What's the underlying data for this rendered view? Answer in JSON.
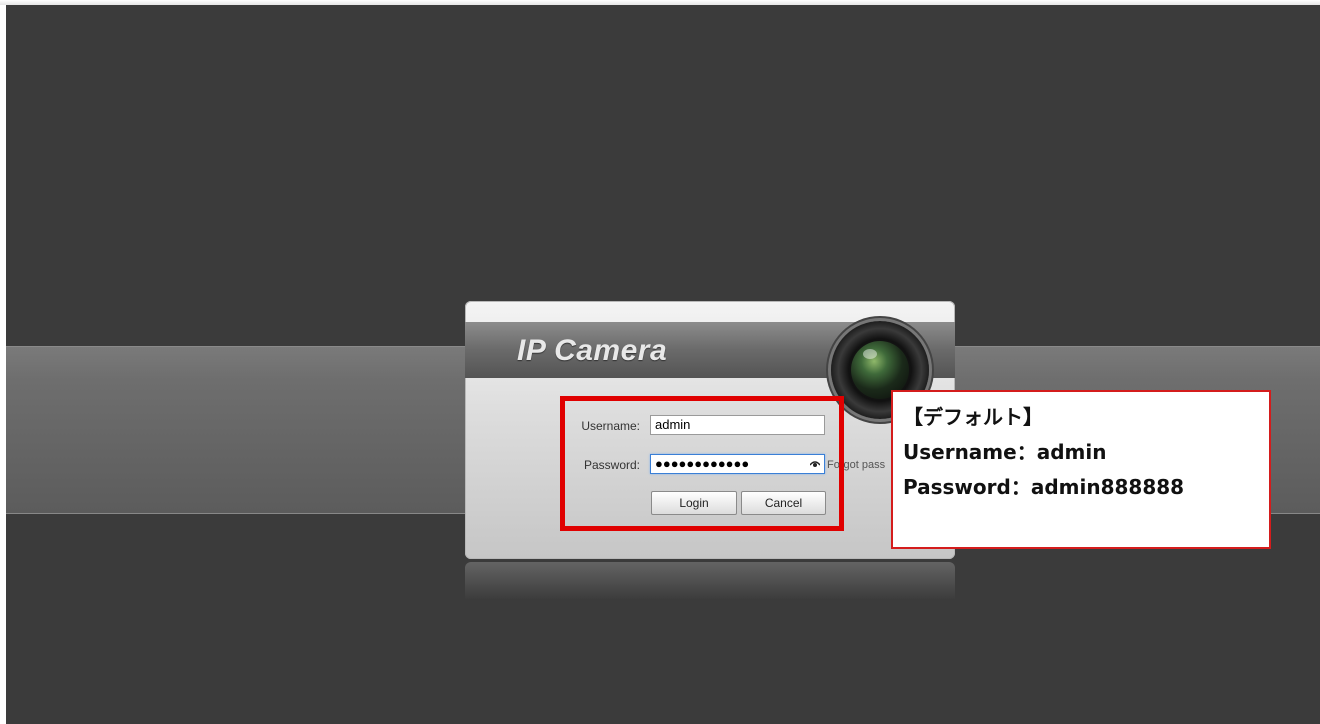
{
  "dialog": {
    "title": "IP Camera",
    "username_label": "Username:",
    "username_value": "admin",
    "password_label": "Password:",
    "password_masked": "●●●●●●●●●●●●",
    "forgot_password": "Forgot pass",
    "login_button": "Login",
    "cancel_button": "Cancel"
  },
  "callout": {
    "line1": "【デフォルト】",
    "line2": "Username：admin",
    "line3": "Password：admin888888"
  },
  "colors": {
    "background": "#3b3b3b",
    "highlight": "#e00000",
    "callout_border": "#d41c1c",
    "focus": "#3a7fd6"
  },
  "icons": {
    "camera_lens": "camera-lens-icon",
    "show_password": "eye-icon"
  }
}
